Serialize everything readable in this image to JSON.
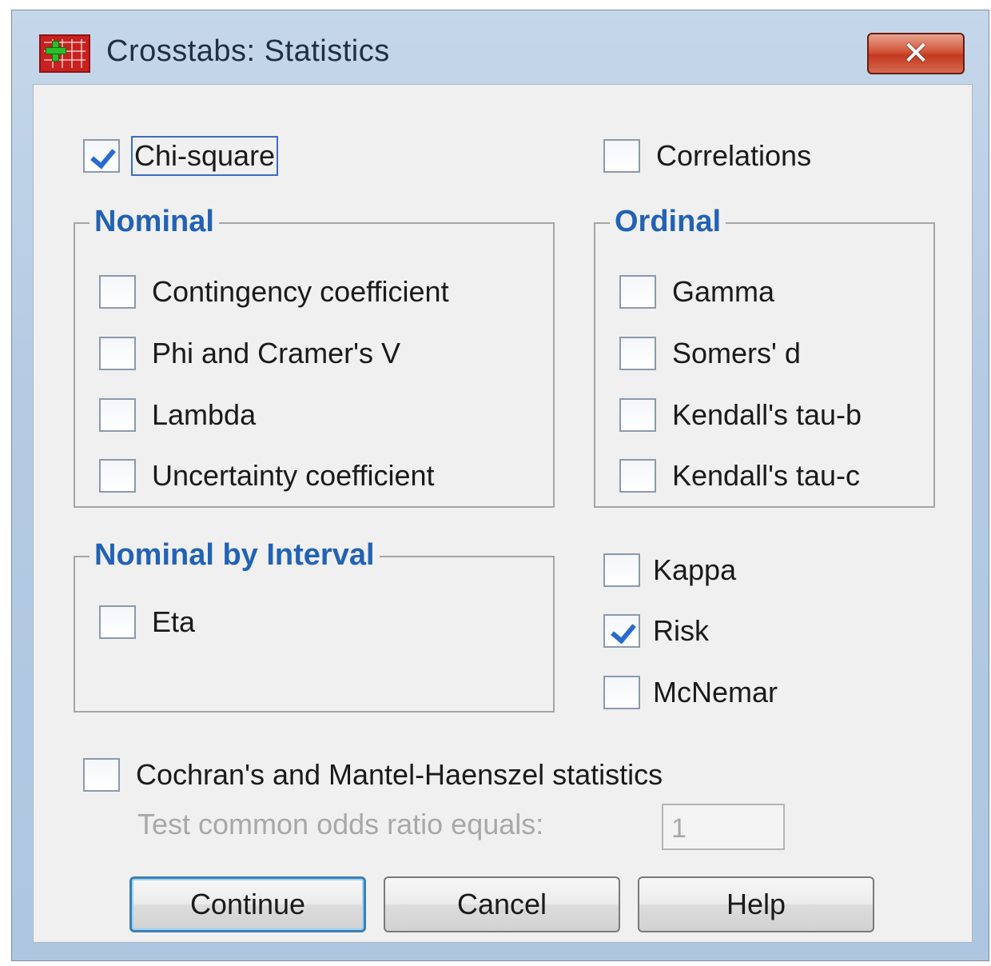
{
  "window": {
    "title": "Crosstabs: Statistics",
    "close_label": "✕"
  },
  "top": {
    "chi_square": {
      "label": "Chi-square",
      "checked": true
    },
    "correlations": {
      "label": "Correlations",
      "checked": false
    }
  },
  "nominal": {
    "legend": "Nominal",
    "items": [
      {
        "label": "Contingency coefficient",
        "checked": false
      },
      {
        "label": "Phi and Cramer's V",
        "checked": false
      },
      {
        "label": "Lambda",
        "checked": false
      },
      {
        "label": "Uncertainty coefficient",
        "checked": false
      }
    ]
  },
  "ordinal": {
    "legend": "Ordinal",
    "items": [
      {
        "label": "Gamma",
        "checked": false
      },
      {
        "label": "Somers' d",
        "checked": false
      },
      {
        "label": "Kendall's tau-b",
        "checked": false
      },
      {
        "label": "Kendall's tau-c",
        "checked": false
      }
    ]
  },
  "nominal_by_interval": {
    "legend": "Nominal by Interval",
    "items": [
      {
        "label": "Eta",
        "checked": false
      }
    ]
  },
  "right_options": [
    {
      "label": "Kappa",
      "checked": false
    },
    {
      "label": "Risk",
      "checked": true
    },
    {
      "label": "McNemar",
      "checked": false
    }
  ],
  "cmh": {
    "label": "Cochran's and Mantel-Haenszel statistics",
    "checked": false,
    "odds_label": "Test common odds ratio equals:",
    "odds_value": "1"
  },
  "buttons": {
    "continue": "Continue",
    "cancel": "Cancel",
    "help": "Help"
  },
  "colors": {
    "legend": "#2262b4",
    "check": "#2a6bd1",
    "close_button": "#c33a21"
  }
}
